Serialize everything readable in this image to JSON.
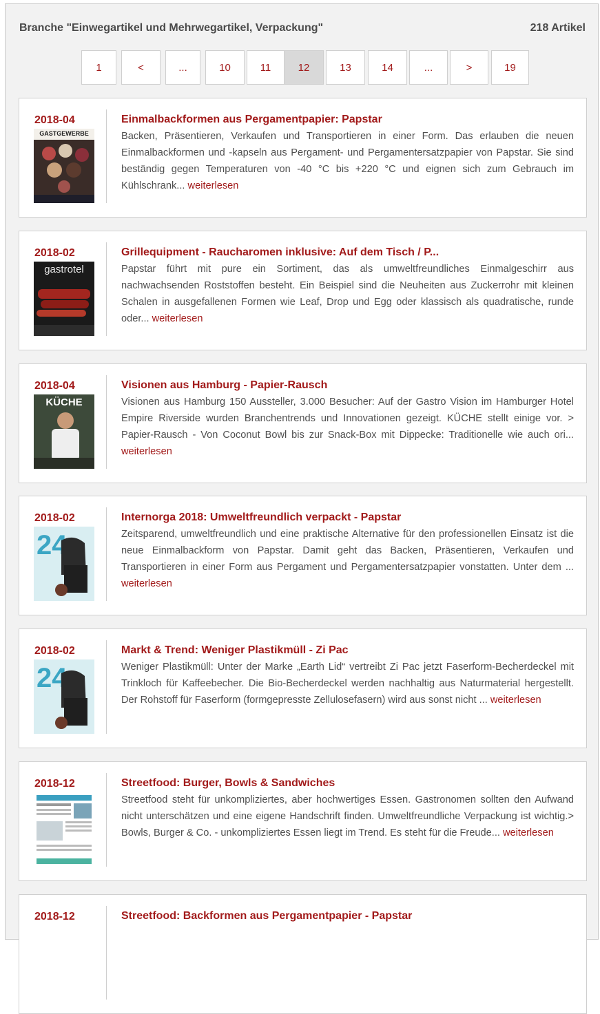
{
  "header": {
    "branche": "Branche \"Einwegartikel und Mehrwegartikel, Verpackung\"",
    "count": "218 Artikel"
  },
  "pagination": {
    "items": [
      "1",
      "<",
      "...",
      "10",
      "11",
      "12",
      "13",
      "14",
      "...",
      ">",
      "19"
    ],
    "active": "12"
  },
  "more_label": "weiterlesen",
  "articles": [
    {
      "date": "2018-04",
      "title": "Einmalbackformen aus Pergamentpapier: Papstar",
      "text": "Backen, Präsentieren, Verkaufen und Transportieren in einer Form. Das erlauben die neuen Einmalbackformen und -kapseln aus Pergament- und Pergamentersatzpapier von Papstar. Sie sind beständig gegen Temperaturen von -40 °C bis +220 °C und eignen sich zum Gebrauch im Kühlschrank...",
      "thumb_label": "GASTGEWERBE"
    },
    {
      "date": "2018-02",
      "title": "Grillequipment - Raucharomen inklusive: Auf dem Tisch / P...",
      "text": "Papstar führt mit pure ein Sortiment, das als umweltfreundliches Einmalgeschirr aus nachwachsenden Roststoffen besteht. Ein Beispiel sind die Neuheiten aus Zuckerrohr mit kleinen Schalen in ausgefallenen Formen wie Leaf, Drop und Egg oder klassisch als quadratische, runde oder...",
      "thumb_label": "gastrotel"
    },
    {
      "date": "2018-04",
      "title": "Visionen aus Hamburg - Papier-Rausch",
      "text": "Visionen aus Hamburg 150 Aussteller, 3.000 Besucher: Auf der Gastro Vision im Hamburger Hotel Empire Riverside wurden Branchentrends und Innovationen gezeigt. KÜCHE stellt einige vor. > Papier-Rausch - Von Coconut Bowl bis zur Snack-Box mit Dippecke: Traditionelle wie auch ori...",
      "thumb_label": "KÜCHE"
    },
    {
      "date": "2018-02",
      "title": "Internorga 2018: Umweltfreundlich verpackt - Papstar",
      "text": "Zeitsparend, umweltfreundlich und eine praktische Alternative für den professionellen Einsatz ist die neue Einmalbackform von Papstar. Damit geht das Backen, Präsentieren, Verkaufen und Transportieren in einer Form aus Pergament und Pergamentersatzpapier vonstatten. Unter dem ...",
      "thumb_label": "24"
    },
    {
      "date": "2018-02",
      "title": "Markt & Trend: Weniger Plastikmüll - Zi Pac",
      "text": "Weniger Plastikmüll: Unter der Marke „Earth Lid“ vertreibt Zi Pac jetzt Faserform-Becherdeckel mit Trinkloch für Kaffeebecher. Die Bio-Becherdeckel werden nachhaltig aus Naturmaterial hergestellt. Der Rohstoff für Faserform (formgepresste Zellulosefasern) wird aus sonst nicht ...",
      "thumb_label": "24"
    },
    {
      "date": "2018-12",
      "title": "Streetfood: Burger, Bowls & Sandwiches",
      "text": "Streetfood steht für unkompliziertes, aber hochwertiges Essen. Gastronomen sollten den Aufwand nicht unterschätzen und eine eigene Handschrift finden. Umweltfreundliche Verpackung ist wichtig.> Bowls, Burger & Co. - unkompliziertes Essen liegt im Trend. Es steht für die Freude...",
      "thumb_label": ""
    },
    {
      "date": "2018-12",
      "title": "Streetfood: Backformen aus Pergamentpapier - Papstar",
      "text": "",
      "thumb_label": ""
    }
  ]
}
